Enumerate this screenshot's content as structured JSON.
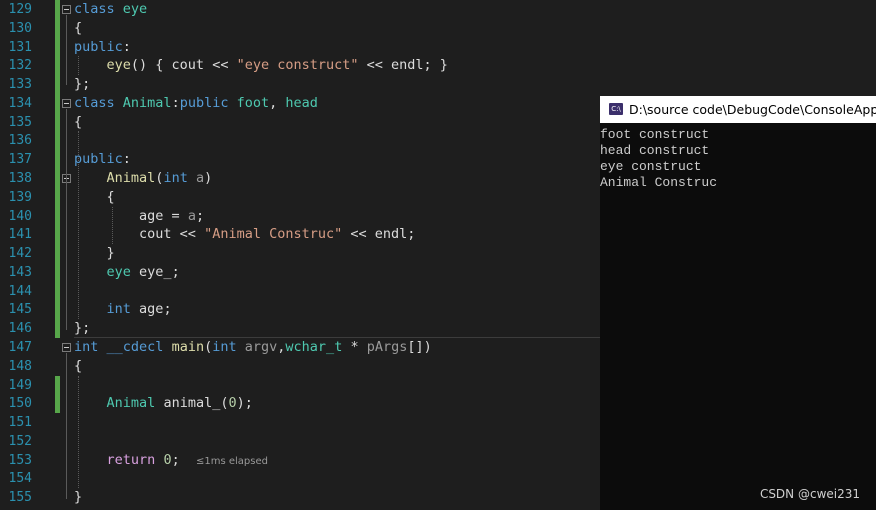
{
  "editor": {
    "line_numbers": [
      "129",
      "130",
      "131",
      "132",
      "133",
      "134",
      "135",
      "136",
      "137",
      "138",
      "139",
      "140",
      "141",
      "142",
      "143",
      "144",
      "145",
      "146",
      "147",
      "148",
      "149",
      "150",
      "151",
      "152",
      "153",
      "154",
      "155"
    ],
    "lines": {
      "l129": {
        "kw": "class",
        "name": "eye"
      },
      "l130": {
        "t": "{"
      },
      "l131": {
        "kw": "public",
        "colon": ":"
      },
      "l132": {
        "fn": "eye",
        "p1": "() { ",
        "cout": "cout",
        " op1": " << ",
        "str": "\"eye construct\"",
        "op2": " << ",
        "endl": "endl",
        "end": "; }"
      },
      "l133": {
        "t": "};"
      },
      "l134": {
        "kw": "class",
        "name": "Animal",
        "sep": ":",
        "kw2": "public",
        "b1": "foot",
        "comma": ", ",
        "b2": "head"
      },
      "l135": {
        "t": "{"
      },
      "l137": {
        "kw": "public",
        "colon": ":"
      },
      "l138": {
        "fn": "Animal",
        "open": "(",
        "ty": "int",
        "param": "a",
        "close": ")"
      },
      "l139": {
        "t": "{"
      },
      "l140": {
        "var": "age",
        "eq": " = ",
        "a": "a",
        "end": ";"
      },
      "l141": {
        "cout": "cout",
        "op1": " << ",
        "str": "\"Animal Construc\"",
        "op2": " << ",
        "endl": "endl",
        "end": ";"
      },
      "l142": {
        "t": "}"
      },
      "l143": {
        "ty": "eye",
        "var": "eye_",
        "end": ";"
      },
      "l145": {
        "kw": "int",
        "var": "age",
        "end": ";"
      },
      "l146": {
        "t": "};"
      },
      "l147": {
        "kw": "int",
        "cc": "__cdecl",
        "fn": "main",
        "open": "(",
        "kw2": "int",
        "p1": "argv",
        "comma": ",",
        "ty": "wchar_t",
        "star": " * ",
        "p2": "pArgs",
        "close": "[])"
      },
      "l148": {
        "t": "{"
      },
      "l150": {
        "ty": "Animal",
        "var": "animal_",
        "open": "(",
        "num": "0",
        "end": ");"
      },
      "l153": {
        "ret": "return",
        "num": "0",
        "end": ";",
        "hint": "≤1ms elapsed"
      },
      "l155": {
        "t": "}"
      }
    }
  },
  "console": {
    "title": "D:\\source code\\DebugCode\\ConsoleAppli",
    "icon_label": "C:\\",
    "output": [
      "foot construct",
      "head construct",
      "eye construct",
      "Animal Construc"
    ]
  },
  "watermark": "CSDN @cwei231",
  "colors": {
    "keyword": "#569cd6",
    "type": "#4ec9b0",
    "function": "#dcdcaa",
    "string": "#d69d85",
    "changed": "#57a64a"
  }
}
